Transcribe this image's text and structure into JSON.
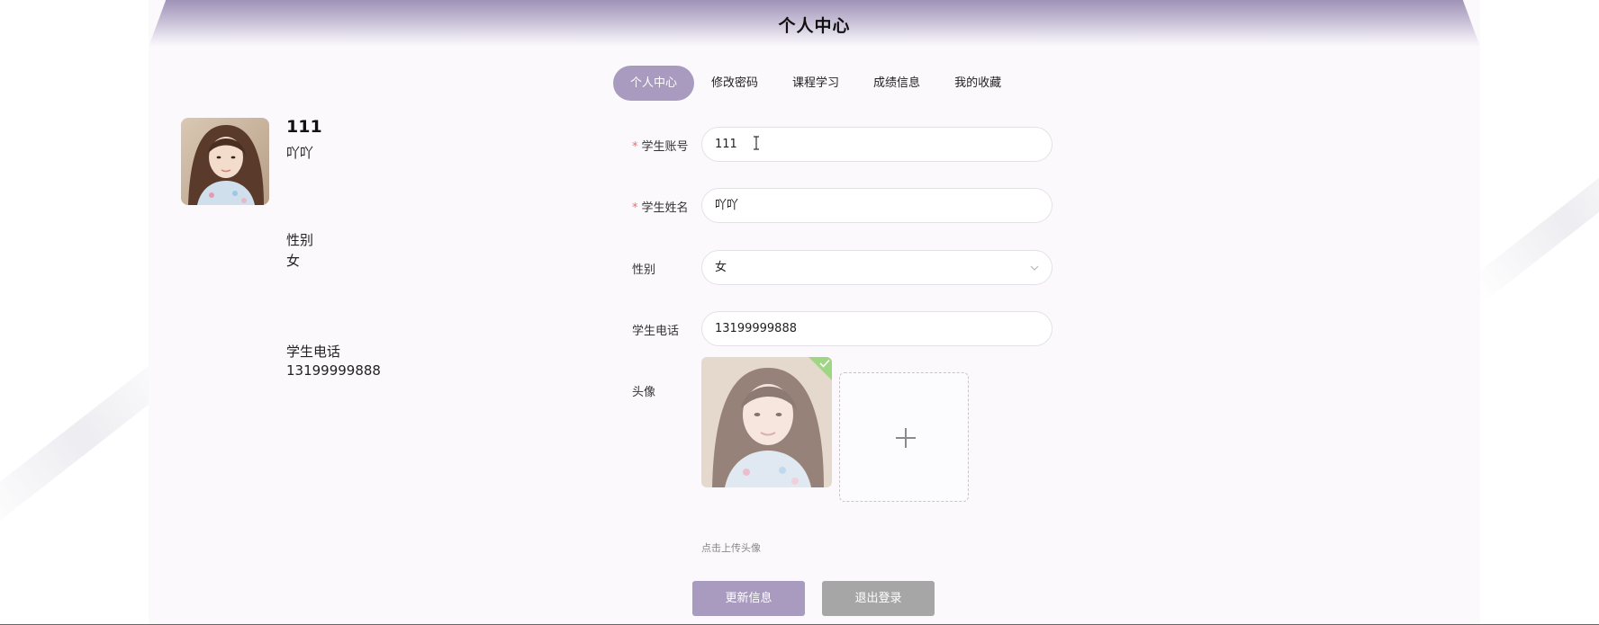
{
  "header": {
    "title": "个人中心"
  },
  "profile": {
    "account": "111",
    "name": "吖吖",
    "gender_label": "性别",
    "gender": "女",
    "phone_label": "学生电话",
    "phone": "13199999888"
  },
  "tabs": [
    {
      "label": "个人中心",
      "active": true
    },
    {
      "label": "修改密码",
      "active": false
    },
    {
      "label": "课程学习",
      "active": false
    },
    {
      "label": "成绩信息",
      "active": false
    },
    {
      "label": "我的收藏",
      "active": false
    }
  ],
  "form": {
    "required_mark": "*",
    "account_label": "学生账号",
    "account_value": "111",
    "name_label": "学生姓名",
    "name_value": "吖吖",
    "gender_label": "性别",
    "gender_value": "女",
    "phone_label": "学生电话",
    "phone_value": "13199999888",
    "avatar_label": "头像",
    "upload_tip": "点击上传头像"
  },
  "buttons": {
    "update": "更新信息",
    "logout": "退出登录"
  },
  "colors": {
    "accent": "#a99bbf",
    "logout": "#a6a6a6",
    "required": "#f56c6c",
    "upload_success": "#67c23a"
  },
  "icons": {
    "select_arrow": "chevron-down-icon",
    "upload_add": "plus-icon",
    "upload_success": "check-icon",
    "text_cursor": "text-cursor-icon"
  }
}
